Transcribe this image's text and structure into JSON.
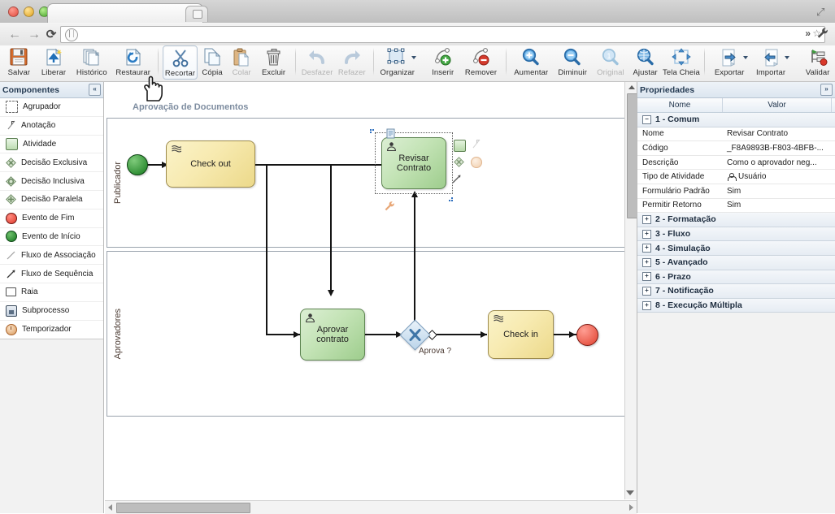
{
  "browser": {
    "tab_title": "",
    "close_icon": "✕",
    "url_value": "",
    "back_icon": "←",
    "forward_icon": "→",
    "reload_icon": "⟳",
    "star_icon": "☆",
    "chevrons_icon": "»",
    "wrench_icon": "🔧",
    "fullscreen_icon": "⤢"
  },
  "toolbar": {
    "items": [
      {
        "label": "Salvar",
        "icon": "save-icon",
        "disabled": false,
        "selected": false,
        "sep_after": false
      },
      {
        "label": "Liberar",
        "icon": "release-icon",
        "disabled": false,
        "selected": false,
        "sep_after": false
      },
      {
        "label": "Histórico",
        "icon": "history-icon",
        "disabled": false,
        "selected": false,
        "sep_after": false
      },
      {
        "label": "Restaurar",
        "icon": "restore-icon",
        "disabled": false,
        "selected": false,
        "sep_after": true
      },
      {
        "label": "Recortar",
        "icon": "cut-icon",
        "disabled": false,
        "selected": true,
        "sep_after": false
      },
      {
        "label": "Cópia",
        "icon": "copy-icon",
        "disabled": false,
        "selected": false,
        "sep_after": false
      },
      {
        "label": "Colar",
        "icon": "paste-icon",
        "disabled": true,
        "selected": false,
        "sep_after": false
      },
      {
        "label": "Excluir",
        "icon": "trash-icon",
        "disabled": false,
        "selected": false,
        "sep_after": true
      },
      {
        "label": "Desfazer",
        "icon": "undo-icon",
        "disabled": true,
        "selected": false,
        "sep_after": false
      },
      {
        "label": "Refazer",
        "icon": "redo-icon",
        "disabled": true,
        "selected": false,
        "sep_after": true
      },
      {
        "label": "Organizar",
        "icon": "organize-icon",
        "disabled": false,
        "selected": false,
        "sep_after": true,
        "dropdown": true
      },
      {
        "label": "Inserir",
        "icon": "insert-point-icon",
        "disabled": false,
        "selected": false,
        "sep_after": false
      },
      {
        "label": "Remover",
        "icon": "remove-point-icon",
        "disabled": false,
        "selected": false,
        "sep_after": true
      },
      {
        "label": "Aumentar",
        "icon": "zoom-in-icon",
        "disabled": false,
        "selected": false,
        "sep_after": false
      },
      {
        "label": "Diminuir",
        "icon": "zoom-out-icon",
        "disabled": false,
        "selected": false,
        "sep_after": false
      },
      {
        "label": "Original",
        "icon": "zoom-original-icon",
        "disabled": true,
        "selected": false,
        "sep_after": false
      },
      {
        "label": "Ajustar",
        "icon": "zoom-fit-icon",
        "disabled": false,
        "selected": false,
        "sep_after": false
      },
      {
        "label": "Tela Cheia",
        "icon": "fullscreen-icon",
        "disabled": false,
        "selected": false,
        "sep_after": true
      },
      {
        "label": "Exportar",
        "icon": "export-icon",
        "disabled": false,
        "selected": false,
        "sep_after": false,
        "dropdown": true
      },
      {
        "label": "Importar",
        "icon": "import-icon",
        "disabled": false,
        "selected": false,
        "sep_after": true,
        "dropdown": true
      },
      {
        "label": "Validar",
        "icon": "validate-icon",
        "disabled": false,
        "selected": false,
        "sep_after": false
      }
    ]
  },
  "components_panel": {
    "title": "Componentes",
    "collapse_icon": "«",
    "items": [
      {
        "label": "Agrupador",
        "icon": "group-icon"
      },
      {
        "label": "Anotação",
        "icon": "annotation-icon"
      },
      {
        "label": "Atividade",
        "icon": "activity-icon"
      },
      {
        "label": "Decisão Exclusiva",
        "icon": "exclusive-gateway-icon"
      },
      {
        "label": "Decisão Inclusiva",
        "icon": "inclusive-gateway-icon"
      },
      {
        "label": "Decisão Paralela",
        "icon": "parallel-gateway-icon"
      },
      {
        "label": "Evento de Fim",
        "icon": "end-event-icon"
      },
      {
        "label": "Evento de Início",
        "icon": "start-event-icon"
      },
      {
        "label": "Fluxo de Associação",
        "icon": "association-flow-icon"
      },
      {
        "label": "Fluxo de Sequência",
        "icon": "sequence-flow-icon"
      },
      {
        "label": "Raia",
        "icon": "lane-icon"
      },
      {
        "label": "Subprocesso",
        "icon": "subprocess-icon"
      },
      {
        "label": "Temporizador",
        "icon": "timer-icon"
      }
    ]
  },
  "properties_panel": {
    "title": "Propriedades",
    "expand_icon": "»",
    "columns": [
      "Nome",
      "Valor"
    ],
    "groups": [
      {
        "label": "1 - Comum",
        "expanded": true,
        "toggle": "−",
        "rows": [
          {
            "name": "Nome",
            "value": "Revisar Contrato",
            "icon": null
          },
          {
            "name": "Código",
            "value": "_F8A9893B-F803-4BFB-...",
            "icon": null
          },
          {
            "name": "Descrição",
            "value": "Como o aprovador neg...",
            "icon": null
          },
          {
            "name": "Tipo de Atividade",
            "value": "Usuário",
            "icon": "user-icon"
          },
          {
            "name": "Formulário Padrão",
            "value": "Sim",
            "icon": null
          },
          {
            "name": "Permitir Retorno",
            "value": "Sim",
            "icon": null
          }
        ]
      },
      {
        "label": "2 - Formatação",
        "expanded": false,
        "toggle": "+",
        "rows": []
      },
      {
        "label": "3 - Fluxo",
        "expanded": false,
        "toggle": "+",
        "rows": []
      },
      {
        "label": "4 - Simulação",
        "expanded": false,
        "toggle": "+",
        "rows": []
      },
      {
        "label": "5 - Avançado",
        "expanded": false,
        "toggle": "+",
        "rows": []
      },
      {
        "label": "6 - Prazo",
        "expanded": false,
        "toggle": "+",
        "rows": []
      },
      {
        "label": "7 - Notificação",
        "expanded": false,
        "toggle": "+",
        "rows": []
      },
      {
        "label": "8 - Execução Múltipla",
        "expanded": false,
        "toggle": "+",
        "rows": []
      }
    ]
  },
  "diagram": {
    "pool_title": "Aprovação de Documentos",
    "lanes": [
      {
        "label": "Publicador"
      },
      {
        "label": "Aprovadores"
      }
    ],
    "nodes": {
      "start_event": {
        "name": "start-event",
        "label": ""
      },
      "check_out": {
        "label": "Check out",
        "type": "script-task",
        "lane": "Publicador"
      },
      "revisar_contrato": {
        "label": "Revisar Contrato",
        "type": "user-task",
        "lane": "Publicador",
        "selected": true
      },
      "aprovar_contrato": {
        "label": "Aprovar contrato",
        "type": "user-task",
        "lane": "Aprovadores"
      },
      "gateway": {
        "label": "Aprova ?",
        "type": "exclusive-gateway",
        "marker": "X"
      },
      "check_in": {
        "label": "Check in",
        "type": "script-task",
        "lane": "Aprovadores"
      },
      "end_event": {
        "name": "end-event",
        "label": ""
      }
    },
    "quick_actions": [
      "activity",
      "annotation",
      "gateway",
      "timer",
      "sequence-flow"
    ],
    "colors": {
      "task_yellow": "#ecd98a",
      "task_green": "#9ecd8d",
      "start_green": "#157a1d",
      "end_red": "#e0412f",
      "gateway_blue": "#bcd5ea",
      "pool_title": "#7e8da0"
    }
  }
}
